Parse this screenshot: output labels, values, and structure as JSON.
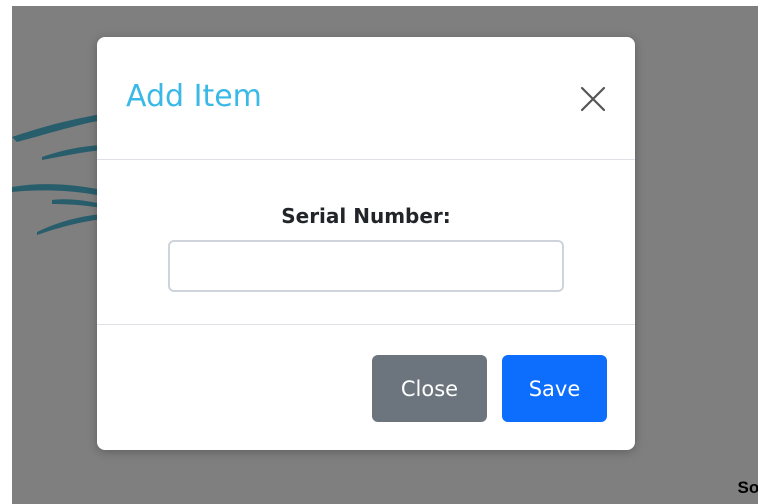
{
  "modal": {
    "title": "Add Item",
    "close_icon": "close-x-icon",
    "field": {
      "label": "Serial Number:",
      "value": "",
      "placeholder": ""
    },
    "buttons": {
      "close_label": "Close",
      "save_label": "Save"
    }
  },
  "background": {
    "corner_text": "Sol",
    "logo_icon": "blue-swoosh-logo"
  },
  "colors": {
    "title": "#3bb9e6",
    "close_button": "#6c757d",
    "save_button": "#0d6efd",
    "backdrop": "rgba(0,0,0,0.5)",
    "logo": "#1f7f9c"
  }
}
